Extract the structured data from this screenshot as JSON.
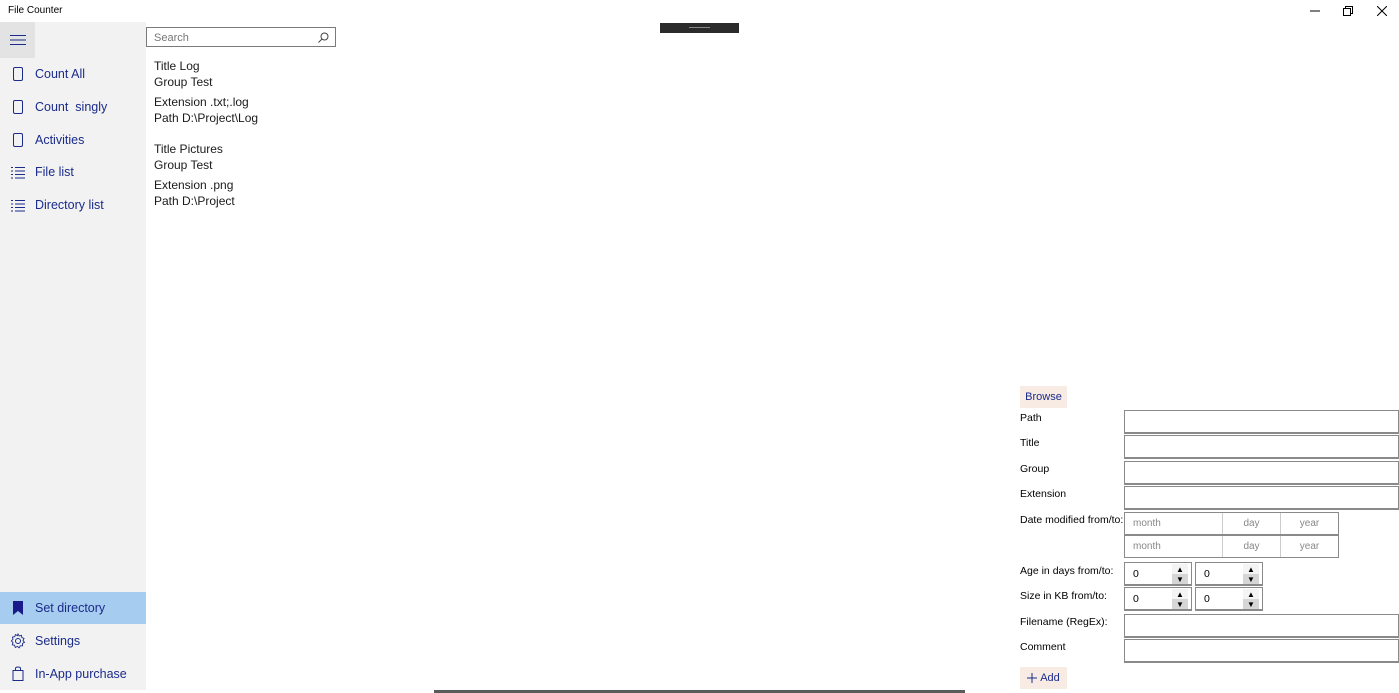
{
  "window": {
    "title": "File Counter"
  },
  "sidebar": {
    "items": [
      {
        "label": "Count All",
        "icon": "tablet-icon"
      },
      {
        "label": "Count  singly",
        "icon": "tablet-icon"
      },
      {
        "label": "Activities",
        "icon": "tablet-icon"
      },
      {
        "label": "File list",
        "icon": "list-icon"
      },
      {
        "label": "Directory list",
        "icon": "list-icon"
      }
    ],
    "bottom_items": [
      {
        "label": "Set directory",
        "icon": "bookmark-icon",
        "selected": true
      },
      {
        "label": "Settings",
        "icon": "gear-icon"
      },
      {
        "label": "In-App purchase",
        "icon": "bag-icon"
      }
    ]
  },
  "search": {
    "placeholder": "Search"
  },
  "entries": [
    {
      "title": "Title Log",
      "group": "Group Test",
      "extension": "Extension .txt;.log",
      "path": "Path D:\\Project\\Log"
    },
    {
      "title": "Title Pictures",
      "group": "Group Test",
      "extension": "Extension .png",
      "path": "Path D:\\Project"
    }
  ],
  "form": {
    "browse_label": "Browse",
    "path_label": "Path",
    "title_label": "Title",
    "group_label": "Group",
    "extension_label": "Extension",
    "date_label": "Date modified from/to:",
    "date_from": {
      "month": "month",
      "day": "day",
      "year": "year"
    },
    "date_to": {
      "month": "month",
      "day": "day",
      "year": "year"
    },
    "age_label": "Age in days from/to:",
    "age_from": "0",
    "age_to": "0",
    "size_label": "Size in KB from/to:",
    "size_from": "0",
    "size_to": "0",
    "filename_label": "Filename (RegEx):",
    "comment_label": "Comment",
    "add_label": "Add"
  },
  "colors": {
    "accent": "#1a2b8a",
    "selected_bg": "#a6cdef",
    "sidebar_bg": "#f2f2f2"
  }
}
